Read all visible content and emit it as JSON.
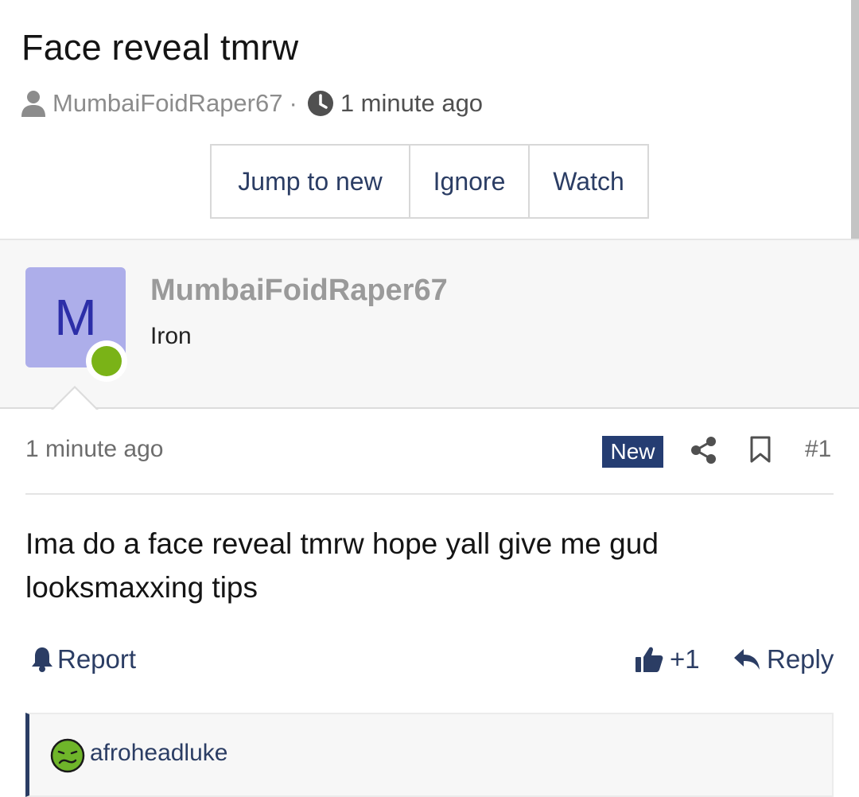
{
  "thread": {
    "title": "Face reveal tmrw",
    "author": "MumbaiFoidRaper67",
    "separator": "·",
    "time": "1 minute ago"
  },
  "buttons": {
    "jump_to_new": "Jump to new",
    "ignore": "Ignore",
    "watch": "Watch"
  },
  "post": {
    "avatar_letter": "M",
    "username": "MumbaiFoidRaper67",
    "user_title": "Iron",
    "time": "1 minute ago",
    "new_badge": "New",
    "post_number": "#1",
    "body": "Ima do a face reveal tmrw hope yall give me gud looksmaxxing tips",
    "report_label": "Report",
    "like_count": "+1",
    "reply_label": "Reply"
  },
  "reactions": {
    "reactor": "afroheadluke",
    "reaction_icon": "nauseated-face-icon"
  },
  "colors": {
    "accent": "#2b3d64",
    "badge": "#253d72",
    "avatar_bg": "#adaeea",
    "avatar_letter": "#2c2ea8",
    "online": "#7ab317"
  },
  "icons": [
    "user-icon",
    "clock-icon",
    "share-icon",
    "bookmark-icon",
    "bell-icon",
    "thumbs-up-icon",
    "reply-arrow-icon",
    "nauseated-face-icon"
  ]
}
